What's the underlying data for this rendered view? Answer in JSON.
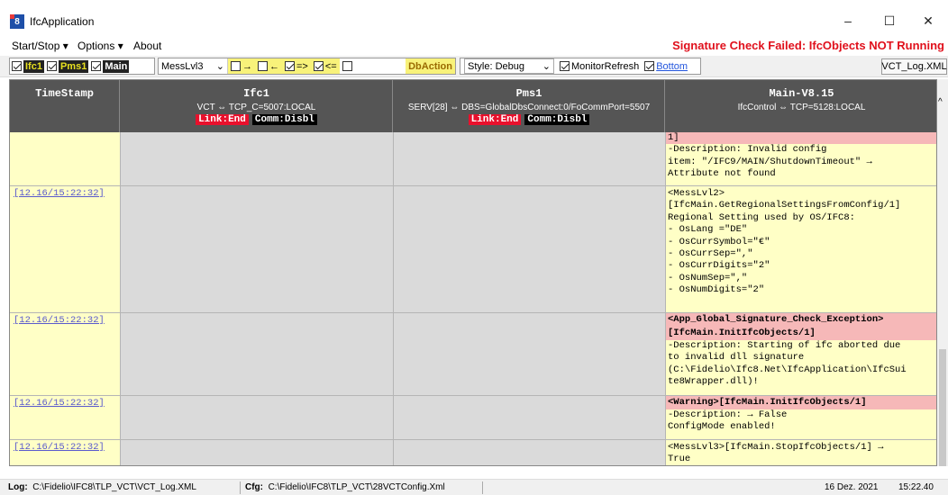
{
  "window": {
    "title": "IfcApplication",
    "icon_label": "8",
    "minimize": "–",
    "maximize": "☐",
    "close": "✕"
  },
  "menu": {
    "start_stop": "Start/Stop ▾",
    "options": "Options ▾",
    "about": "About"
  },
  "warning": "Signature Check Failed: IfcObjects NOT Running",
  "toolbar": {
    "ifc1": "Ifc1",
    "pms1": "Pms1",
    "main": "Main",
    "level": "MessLvl3",
    "dir_right": "→",
    "dir_left": "←",
    "dir_out": "=>",
    "dir_in": "<=",
    "dbaction": "DbAction",
    "style": "Style: Debug",
    "monitor_refresh": "MonitorRefresh",
    "bottom": "Bottom",
    "log_button": "VCT_Log.XML"
  },
  "columns": {
    "timestamp": "TimeStamp",
    "ifc1": {
      "title": "Ifc1",
      "sub": "VCT ⇔ TCP_C=5007:LOCAL",
      "link": "Link:End",
      "comm": "Comm:Disbl"
    },
    "pms1": {
      "title": "Pms1",
      "sub": "SERV[28] ⇔ DBS=GlobalDbsConnect:0/FoCommPort=5507",
      "link": "Link:End",
      "comm": "Comm:Disbl"
    },
    "main": {
      "title": "Main-V8.15",
      "sub": "IfcControl ⇔ TCP=5128:LOCAL"
    }
  },
  "rows": [
    {
      "ts": "",
      "lines": [
        "1]",
        "-Description: Invalid config",
        "item: \"/IFC9/MAIN/ShutdownTimeout\" →",
        "Attribute not found"
      ]
    },
    {
      "ts": "[12.16/15:22:32]",
      "lines": [
        "<MessLvl2>",
        "[IfcMain.GetRegionalSettingsFromConfig/1]",
        "Regional Setting used by OS/IFC8:",
        "- OsLang =\"DE\"",
        "- OsCurrSymbol=\"€\"",
        "- OsCurrSep=\",\"",
        "- OsCurrDigits=\"2\"",
        "- OsNumSep=\",\"",
        "- OsNumDigits=\"2\""
      ]
    },
    {
      "ts": "[12.16/15:22:32]",
      "lines": [
        "<App_Global_Signature_Check_Exception>",
        "[IfcMain.InitIfcObjects/1]",
        "-Description: Starting of ifc aborted due",
        "to invalid dll signature",
        "(C:\\Fidelio\\Ifc8.Net\\IfcApplication\\IfcSui",
        "te8Wrapper.dll)!"
      ]
    },
    {
      "ts": "[12.16/15:22:32]",
      "lines": [
        "<Warning>[IfcMain.InitIfcObjects/1]",
        "-Description: → False",
        "ConfigMode enabled!"
      ]
    },
    {
      "ts": "[12.16/15:22:32]",
      "lines": [
        "<MessLvl3>[IfcMain.StopIfcObjects/1] →",
        "True"
      ]
    }
  ],
  "status": {
    "log_label": "Log:",
    "log_path": "C:\\Fidelio\\IFC8\\TLP_VCT\\VCT_Log.XML",
    "cfg_label": "Cfg:",
    "cfg_path": "C:\\Fidelio\\IFC8\\TLP_VCT\\28VCTConfig.Xml",
    "date": "16 Dez. 2021",
    "time": "15:22.40"
  }
}
